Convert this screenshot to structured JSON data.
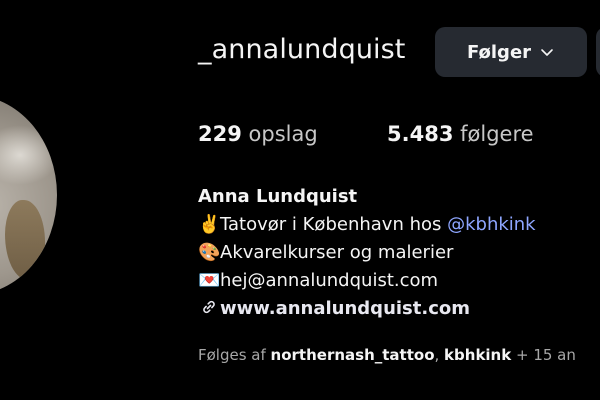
{
  "profile": {
    "username": "_annalundquist",
    "follow_button_label": "Følger",
    "stats": [
      {
        "count": "229",
        "label": "opslag"
      },
      {
        "count": "5.483",
        "label": "følgere"
      }
    ],
    "bio": {
      "name": "Anna Lundquist",
      "line1_emoji": "✌️",
      "line1_text": "Tatovør i København hos ",
      "line1_mention": "@kbhkink",
      "line2_emoji": "🎨",
      "line2_text": "Akvarelkurser og malerier",
      "line3_emoji": "💌",
      "line3_text": "hej@annalundquist.com",
      "website": "www.annalundquist.com"
    },
    "followed_by": {
      "prefix": "Følges af ",
      "account1": "northernash_tattoo",
      "separator": ", ",
      "account2": "kbhkink",
      "suffix": " + 15 an"
    }
  },
  "icons": {
    "follow_dropdown": "chevron-down-icon",
    "website_link": "link-icon"
  },
  "colors": {
    "background": "#000000",
    "button_bg": "#262a31",
    "mention": "#8ea6ff",
    "secondary_text": "#a8a8a8"
  }
}
